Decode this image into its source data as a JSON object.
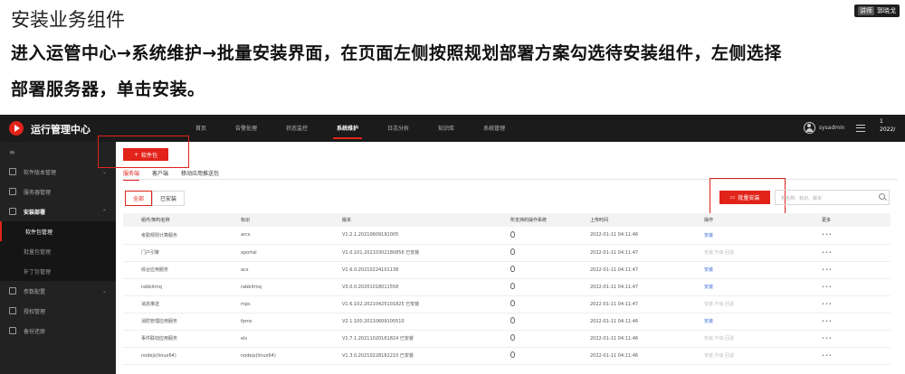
{
  "slide": {
    "title": "安装业务组件",
    "line1": "进入运管中心→系统维护→批量安装界面，在页面左侧按照规划部署方案勾选待安装组件，左侧选择",
    "line2": "部署服务器，单击安装。",
    "presenter_tag": "讲师",
    "presenter_name": "郭晓戈"
  },
  "app": {
    "title": "运行管理中心",
    "nav": [
      "首页",
      "告警处理",
      "状态监控",
      "系统维护",
      "日志分析",
      "知识库",
      "系统管理"
    ],
    "active_nav": 3,
    "user": "sysadmin",
    "clipped_right": "1\n2022/"
  },
  "sidebar": {
    "collapse": "≡",
    "items": [
      {
        "label": "软件版本管理",
        "type": "item"
      },
      {
        "label": "服务器管理",
        "type": "item"
      },
      {
        "label": "安装部署",
        "type": "parent"
      },
      {
        "label": "软件包管理",
        "type": "sub",
        "active": true
      },
      {
        "label": "批量包管理",
        "type": "sub"
      },
      {
        "label": "补丁包管理",
        "type": "sub"
      },
      {
        "label": "参数配置",
        "type": "item",
        "chev": "⌄"
      },
      {
        "label": "授权管理",
        "type": "item"
      },
      {
        "label": "备份还原",
        "type": "item"
      }
    ]
  },
  "content": {
    "pkg_button": "软件包",
    "tabs": [
      "服务端",
      "客户端",
      "移动应用推送包"
    ],
    "filters": [
      "全部",
      "已安装"
    ],
    "batch_button": "批量安装",
    "search_placeholder": "包名称、标识、版本",
    "table": {
      "headers": [
        "组件/架构名称",
        "标识",
        "版本",
        "所支持的操作系统",
        "上传时间",
        "操作",
        "更多"
      ],
      "rows": [
        [
          "考勤规则计算服务",
          "arcs",
          "V1.2.1.20210609191005",
          "",
          "2022-01-11 04:11:46",
          "安装",
          "•••"
        ],
        [
          "门户引擎",
          "xportal",
          "V1.0.101.20210302180856 已安装",
          "",
          "2022-01-11 04:11:47",
          "安装  升级  回退",
          "•••"
        ],
        [
          "综合应用服务",
          "acs",
          "V1.6.0.20210224101138",
          "",
          "2022-01-11 04:11:47",
          "安装",
          "•••"
        ],
        [
          "rabbitmq",
          "rabbitmq",
          "V3.0.0.20201018011558",
          "",
          "2022-01-11 04:11:47",
          "安装",
          "•••"
        ],
        [
          "消息推送",
          "mps",
          "V1.6.102.20210425101825 已安装",
          "",
          "2022-01-11 04:11:47",
          "安装  升级  回退",
          "•••"
        ],
        [
          "消防管理应用服务",
          "fpms",
          "V2.1.100.20210609100510",
          "",
          "2022-01-11 04:11:46",
          "安装",
          "•••"
        ],
        [
          "事件联动应用服务",
          "els",
          "V1.7.1.20211020161824 已安装",
          "",
          "2022-01-11 04:11:46",
          "安装  升级  回退",
          "•••"
        ],
        [
          "nodejs(linux64)",
          "nodejs(linux64)",
          "V1.3.0.20210228162210 已安装",
          "",
          "2022-01-11 04:11:46",
          "安装  升级  回退",
          "•••"
        ]
      ]
    }
  }
}
